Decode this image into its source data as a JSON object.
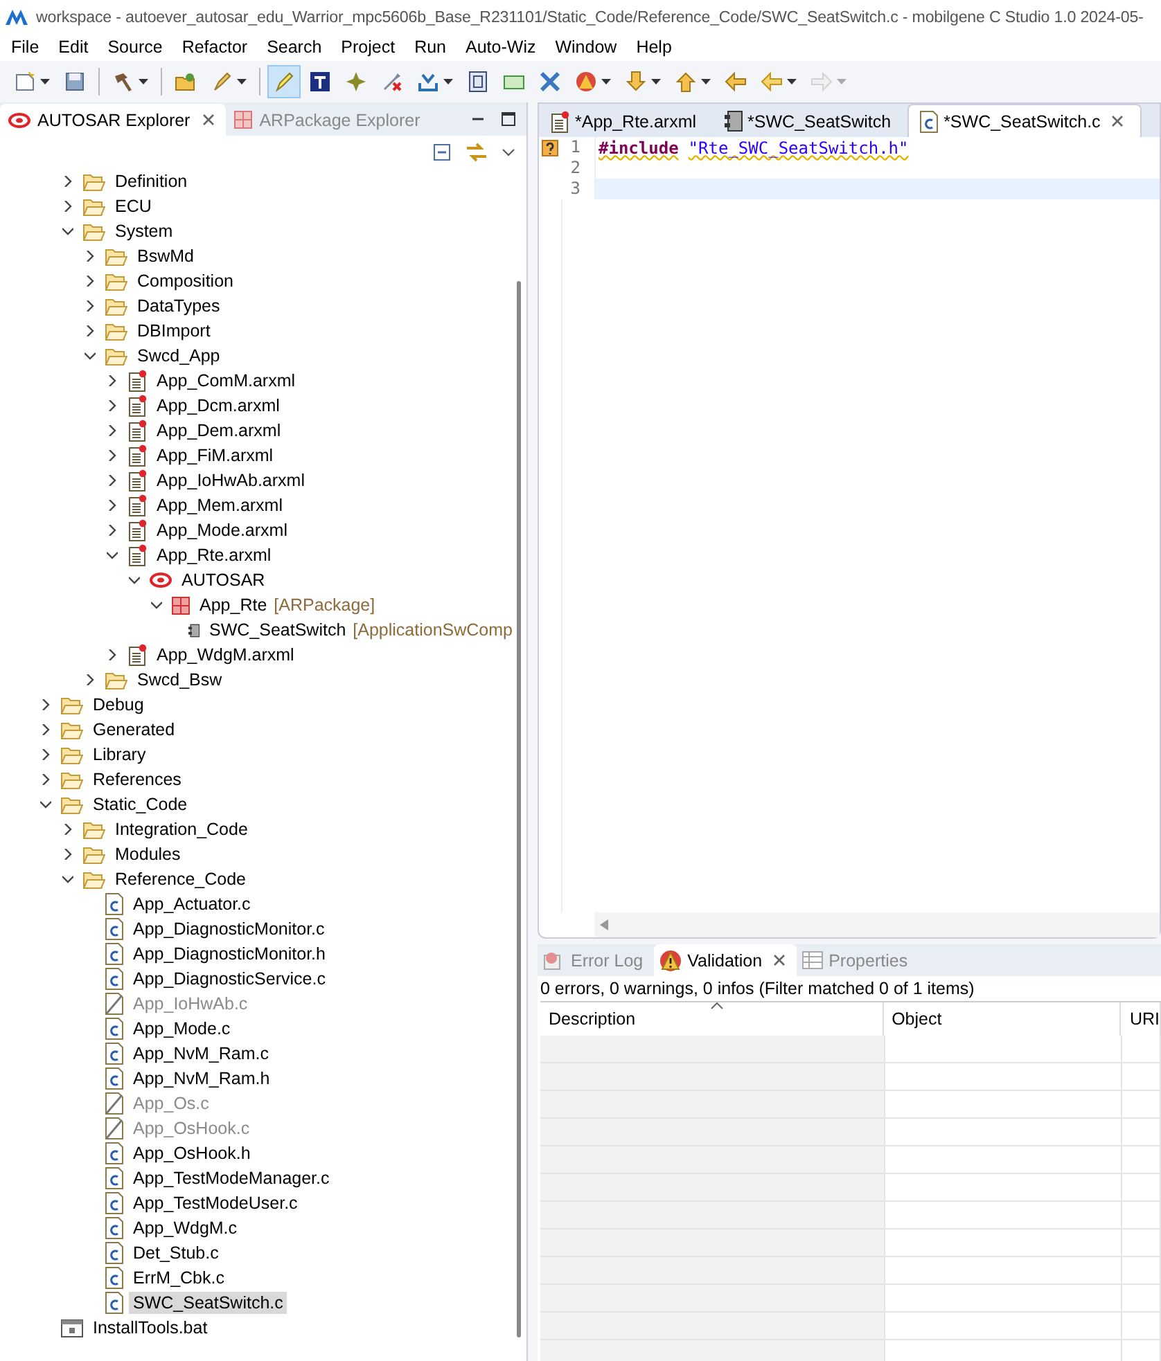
{
  "window": {
    "title": "workspace - autoever_autosar_edu_Warrior_mpc5606b_Base_R231101/Static_Code/Reference_Code/SWC_SeatSwitch.c - mobilgene C Studio 1.0 2024-05-"
  },
  "menu": [
    "File",
    "Edit",
    "Source",
    "Refactor",
    "Search",
    "Project",
    "Run",
    "Auto-Wiz",
    "Window",
    "Help"
  ],
  "toolbar": [
    {
      "pressed": false,
      "disabled": false,
      "dropdown": true
    },
    {
      "pressed": false,
      "disabled": false,
      "dropdown": false
    },
    {
      "pressed": false,
      "disabled": false,
      "dropdown": true
    },
    {
      "pressed": false,
      "disabled": false,
      "dropdown": false
    },
    {
      "pressed": false,
      "disabled": false,
      "dropdown": true
    },
    {
      "pressed": true,
      "disabled": false,
      "dropdown": false
    },
    {
      "pressed": false,
      "disabled": false,
      "dropdown": false
    },
    {
      "pressed": false,
      "disabled": false,
      "dropdown": false
    },
    {
      "pressed": false,
      "disabled": false,
      "dropdown": false
    },
    {
      "pressed": false,
      "disabled": false,
      "dropdown": true
    },
    {
      "pressed": false,
      "disabled": false,
      "dropdown": false
    },
    {
      "pressed": false,
      "disabled": false,
      "dropdown": false
    },
    {
      "pressed": false,
      "disabled": false,
      "dropdown": false
    },
    {
      "pressed": false,
      "disabled": false,
      "dropdown": true
    },
    {
      "pressed": false,
      "disabled": false,
      "dropdown": true
    },
    {
      "pressed": false,
      "disabled": false,
      "dropdown": true
    },
    {
      "pressed": false,
      "disabled": false,
      "dropdown": false
    },
    {
      "pressed": false,
      "disabled": false,
      "dropdown": true
    },
    {
      "pressed": false,
      "disabled": true,
      "dropdown": true
    }
  ],
  "explorer": {
    "tabs": [
      {
        "label": "AUTOSAR Explorer",
        "selected": true
      },
      {
        "label": "ARPackage Explorer",
        "selected": false
      }
    ],
    "tree": {
      "partial_group": [
        {
          "label": "Definition",
          "kind": "folder",
          "expanded": false,
          "selected": false,
          "disabled": false
        },
        {
          "label": "ECU",
          "kind": "folder",
          "expanded": false,
          "selected": false,
          "disabled": false
        },
        {
          "label": "System",
          "kind": "folder",
          "expanded": true,
          "selected": false,
          "disabled": false,
          "children": [
            {
              "label": "BswMd",
              "kind": "folder",
              "expanded": false,
              "selected": false,
              "disabled": false
            },
            {
              "label": "Composition",
              "kind": "folder",
              "expanded": false,
              "selected": false,
              "disabled": false
            },
            {
              "label": "DataTypes",
              "kind": "folder",
              "expanded": false,
              "selected": false,
              "disabled": false
            },
            {
              "label": "DBImport",
              "kind": "folder",
              "expanded": false,
              "selected": false,
              "disabled": false
            },
            {
              "label": "Swcd_App",
              "kind": "folder",
              "expanded": true,
              "selected": false,
              "disabled": false,
              "children": [
                {
                  "label": "App_ComM.arxml",
                  "kind": "arxml",
                  "expanded": false,
                  "selected": false,
                  "disabled": false
                },
                {
                  "label": "App_Dcm.arxml",
                  "kind": "arxml",
                  "expanded": false,
                  "selected": false,
                  "disabled": false
                },
                {
                  "label": "App_Dem.arxml",
                  "kind": "arxml",
                  "expanded": false,
                  "selected": false,
                  "disabled": false
                },
                {
                  "label": "App_FiM.arxml",
                  "kind": "arxml",
                  "expanded": false,
                  "selected": false,
                  "disabled": false
                },
                {
                  "label": "App_IoHwAb.arxml",
                  "kind": "arxml",
                  "expanded": false,
                  "selected": false,
                  "disabled": false
                },
                {
                  "label": "App_Mem.arxml",
                  "kind": "arxml",
                  "expanded": false,
                  "selected": false,
                  "disabled": false
                },
                {
                  "label": "App_Mode.arxml",
                  "kind": "arxml",
                  "expanded": false,
                  "selected": false,
                  "disabled": false
                },
                {
                  "label": "App_Rte.arxml",
                  "kind": "arxml",
                  "expanded": true,
                  "selected": false,
                  "disabled": false,
                  "children": [
                    {
                      "label": "AUTOSAR",
                      "kind": "autosar",
                      "expanded": true,
                      "selected": false,
                      "disabled": false,
                      "children": [
                        {
                          "label": "App_Rte",
                          "suffix": "[ARPackage]",
                          "kind": "package",
                          "expanded": true,
                          "selected": false,
                          "disabled": false,
                          "children": [
                            {
                              "label": "SWC_SeatSwitch",
                              "suffix": "[ApplicationSwComp",
                              "kind": "component",
                              "selected": false,
                              "disabled": false
                            }
                          ]
                        }
                      ]
                    }
                  ]
                },
                {
                  "label": "App_WdgM.arxml",
                  "kind": "arxml",
                  "expanded": false,
                  "selected": false,
                  "disabled": false
                }
              ]
            },
            {
              "label": "Swcd_Bsw",
              "kind": "folder",
              "expanded": false,
              "selected": false,
              "disabled": false
            }
          ]
        }
      ],
      "items": [
        {
          "label": "Debug",
          "kind": "folder",
          "expanded": false,
          "selected": false,
          "disabled": false
        },
        {
          "label": "Generated",
          "kind": "folder",
          "expanded": false,
          "selected": false,
          "disabled": false
        },
        {
          "label": "Library",
          "kind": "folder",
          "expanded": false,
          "selected": false,
          "disabled": false
        },
        {
          "label": "References",
          "kind": "folder",
          "expanded": false,
          "selected": false,
          "disabled": false
        },
        {
          "label": "Static_Code",
          "kind": "folder",
          "expanded": true,
          "selected": false,
          "disabled": false,
          "children": [
            {
              "label": "Integration_Code",
              "kind": "folder",
              "expanded": false,
              "selected": false,
              "disabled": false
            },
            {
              "label": "Modules",
              "kind": "folder",
              "expanded": false,
              "selected": false,
              "disabled": false
            },
            {
              "label": "Reference_Code",
              "kind": "folder",
              "expanded": true,
              "selected": false,
              "disabled": false,
              "children": [
                {
                  "label": "App_Actuator.c",
                  "kind": "cfile",
                  "selected": false,
                  "disabled": false
                },
                {
                  "label": "App_DiagnosticMonitor.c",
                  "kind": "cfile",
                  "selected": false,
                  "disabled": false
                },
                {
                  "label": "App_DiagnosticMonitor.h",
                  "kind": "cfile",
                  "selected": false,
                  "disabled": false
                },
                {
                  "label": "App_DiagnosticService.c",
                  "kind": "cfile",
                  "selected": false,
                  "disabled": false
                },
                {
                  "label": "App_IoHwAb.c",
                  "kind": "cfile",
                  "selected": false,
                  "disabled": true
                },
                {
                  "label": "App_Mode.c",
                  "kind": "cfile",
                  "selected": false,
                  "disabled": false
                },
                {
                  "label": "App_NvM_Ram.c",
                  "kind": "cfile",
                  "selected": false,
                  "disabled": false
                },
                {
                  "label": "App_NvM_Ram.h",
                  "kind": "cfile",
                  "selected": false,
                  "disabled": false
                },
                {
                  "label": "App_Os.c",
                  "kind": "cfile",
                  "selected": false,
                  "disabled": true
                },
                {
                  "label": "App_OsHook.c",
                  "kind": "cfile",
                  "selected": false,
                  "disabled": true
                },
                {
                  "label": "App_OsHook.h",
                  "kind": "cfile",
                  "selected": false,
                  "disabled": false
                },
                {
                  "label": "App_TestModeManager.c",
                  "kind": "cfile",
                  "selected": false,
                  "disabled": false
                },
                {
                  "label": "App_TestModeUser.c",
                  "kind": "cfile",
                  "selected": false,
                  "disabled": false
                },
                {
                  "label": "App_WdgM.c",
                  "kind": "cfile",
                  "selected": false,
                  "disabled": false
                },
                {
                  "label": "Det_Stub.c",
                  "kind": "cfile",
                  "selected": false,
                  "disabled": false
                },
                {
                  "label": "ErrM_Cbk.c",
                  "kind": "cfile",
                  "selected": false,
                  "disabled": false
                },
                {
                  "label": "SWC_SeatSwitch.c",
                  "kind": "cfile",
                  "selected": true,
                  "disabled": false
                }
              ]
            }
          ]
        },
        {
          "label": "InstallTools.bat",
          "kind": "bat",
          "selected": false,
          "disabled": false
        }
      ]
    }
  },
  "editor": {
    "tabs": [
      {
        "label": "*App_Rte.arxml",
        "kind": "arxml",
        "selected": false
      },
      {
        "label": "*SWC_SeatSwitch",
        "kind": "component",
        "selected": false
      },
      {
        "label": "*SWC_SeatSwitch.c",
        "kind": "cfile",
        "selected": true
      }
    ],
    "lines": [
      {
        "number": "1",
        "marker": true,
        "current": false,
        "tokens": [
          {
            "kind": "keyword",
            "text": "#include"
          },
          {
            "kind": "string",
            "text": "\"Rte_SWC_SeatSwitch.h\""
          }
        ]
      },
      {
        "number": "2",
        "marker": false,
        "current": false
      },
      {
        "number": "3",
        "marker": false,
        "current": true
      }
    ]
  },
  "validation": {
    "tabs": [
      {
        "label": "Error Log",
        "kind": "log",
        "selected": false
      },
      {
        "label": "Validation",
        "kind": "warning",
        "selected": true
      },
      {
        "label": "Properties",
        "kind": "table",
        "selected": false
      }
    ],
    "summary": "0 errors, 0 warnings, 0 infos (Filter matched 0 of 1 items)",
    "columns": [
      {
        "label": "Description",
        "sorted": true
      },
      {
        "label": "Object",
        "sorted": false
      },
      {
        "label": "URI",
        "sorted": false
      }
    ]
  }
}
